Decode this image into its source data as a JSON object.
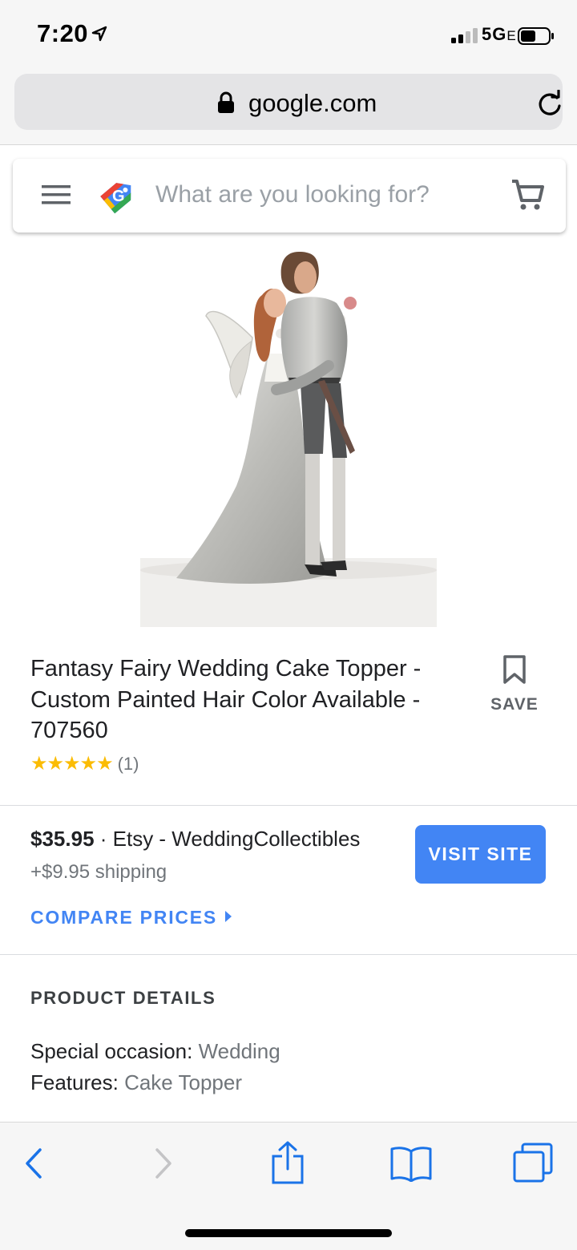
{
  "status_bar": {
    "time": "7:20",
    "network": "5G",
    "network_suffix": "E"
  },
  "browser": {
    "url": "google.com"
  },
  "search": {
    "placeholder": "What are you looking for?"
  },
  "product": {
    "title": "Fantasy Fairy Wedding Cake Topper - Custom Painted Hair Color Available - 707560",
    "save_label": "SAVE",
    "rating_stars": "★★★★★",
    "rating": 5,
    "review_count": "(1)"
  },
  "offer": {
    "price": "$35.95",
    "separator": " · ",
    "seller": "Etsy - WeddingCollectibles",
    "shipping": "+$9.95 shipping",
    "visit_label": "VISIT SITE",
    "compare_label": "COMPARE PRICES"
  },
  "details": {
    "heading": "PRODUCT DETAILS",
    "rows": [
      {
        "label": "Special occasion:",
        "value": "Wedding"
      },
      {
        "label": "Features:",
        "value": "Cake Topper"
      }
    ]
  },
  "colors": {
    "accent": "#4285f4",
    "star": "#fbbc04"
  }
}
